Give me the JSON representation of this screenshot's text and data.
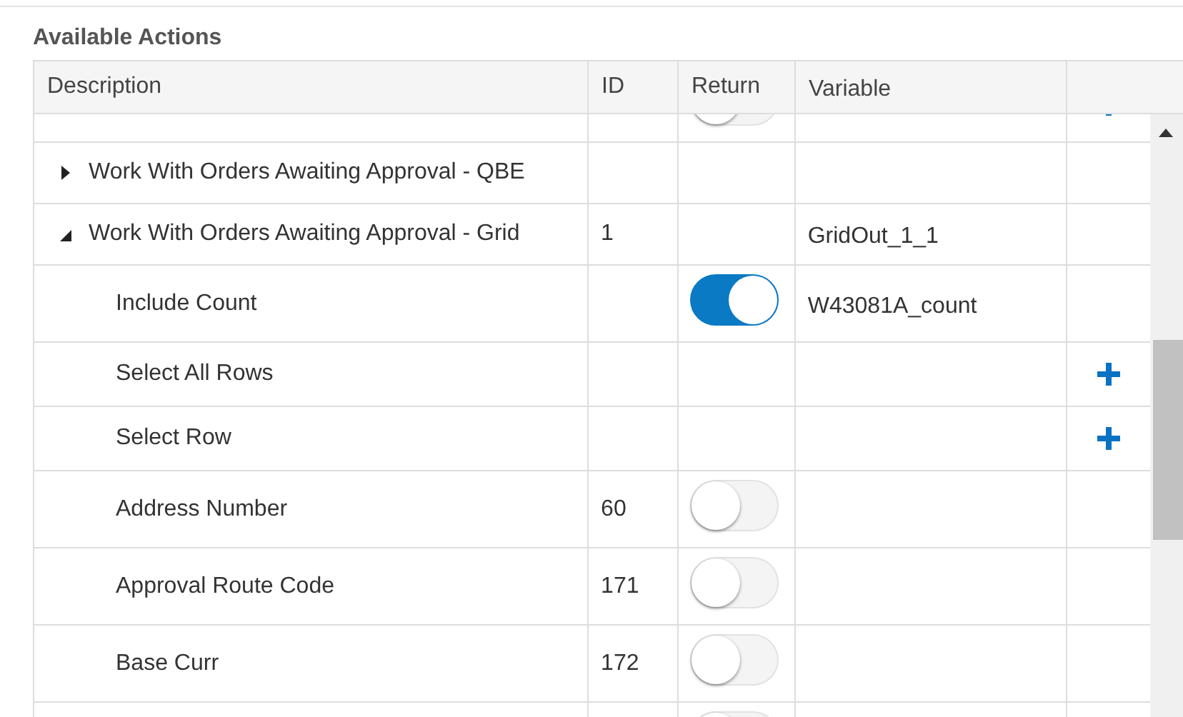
{
  "title": "Available Actions",
  "columns": [
    "Description",
    "ID",
    "Return",
    "Variable"
  ],
  "rows": [
    {
      "kind": "child",
      "return": false,
      "add": true
    },
    {
      "kind": "group",
      "description": "Work With Orders Awaiting Approval - QBE",
      "expanded": false
    },
    {
      "kind": "group",
      "description": "Work With Orders Awaiting Approval - Grid",
      "id": "1",
      "expanded": true,
      "variable": "GridOut_1_1"
    },
    {
      "kind": "child",
      "description": "Include Count",
      "return": true,
      "variable": "W43081A_count"
    },
    {
      "kind": "child",
      "description": "Select All Rows",
      "add": true
    },
    {
      "kind": "child",
      "description": "Select Row",
      "add": true
    },
    {
      "kind": "child",
      "description": "Address Number",
      "id": "60",
      "return": false
    },
    {
      "kind": "child",
      "description": "Approval Route Code",
      "id": "171",
      "return": false
    },
    {
      "kind": "child",
      "description": "Base Curr",
      "id": "172",
      "return": false
    },
    {
      "kind": "child",
      "return": false
    }
  ]
}
